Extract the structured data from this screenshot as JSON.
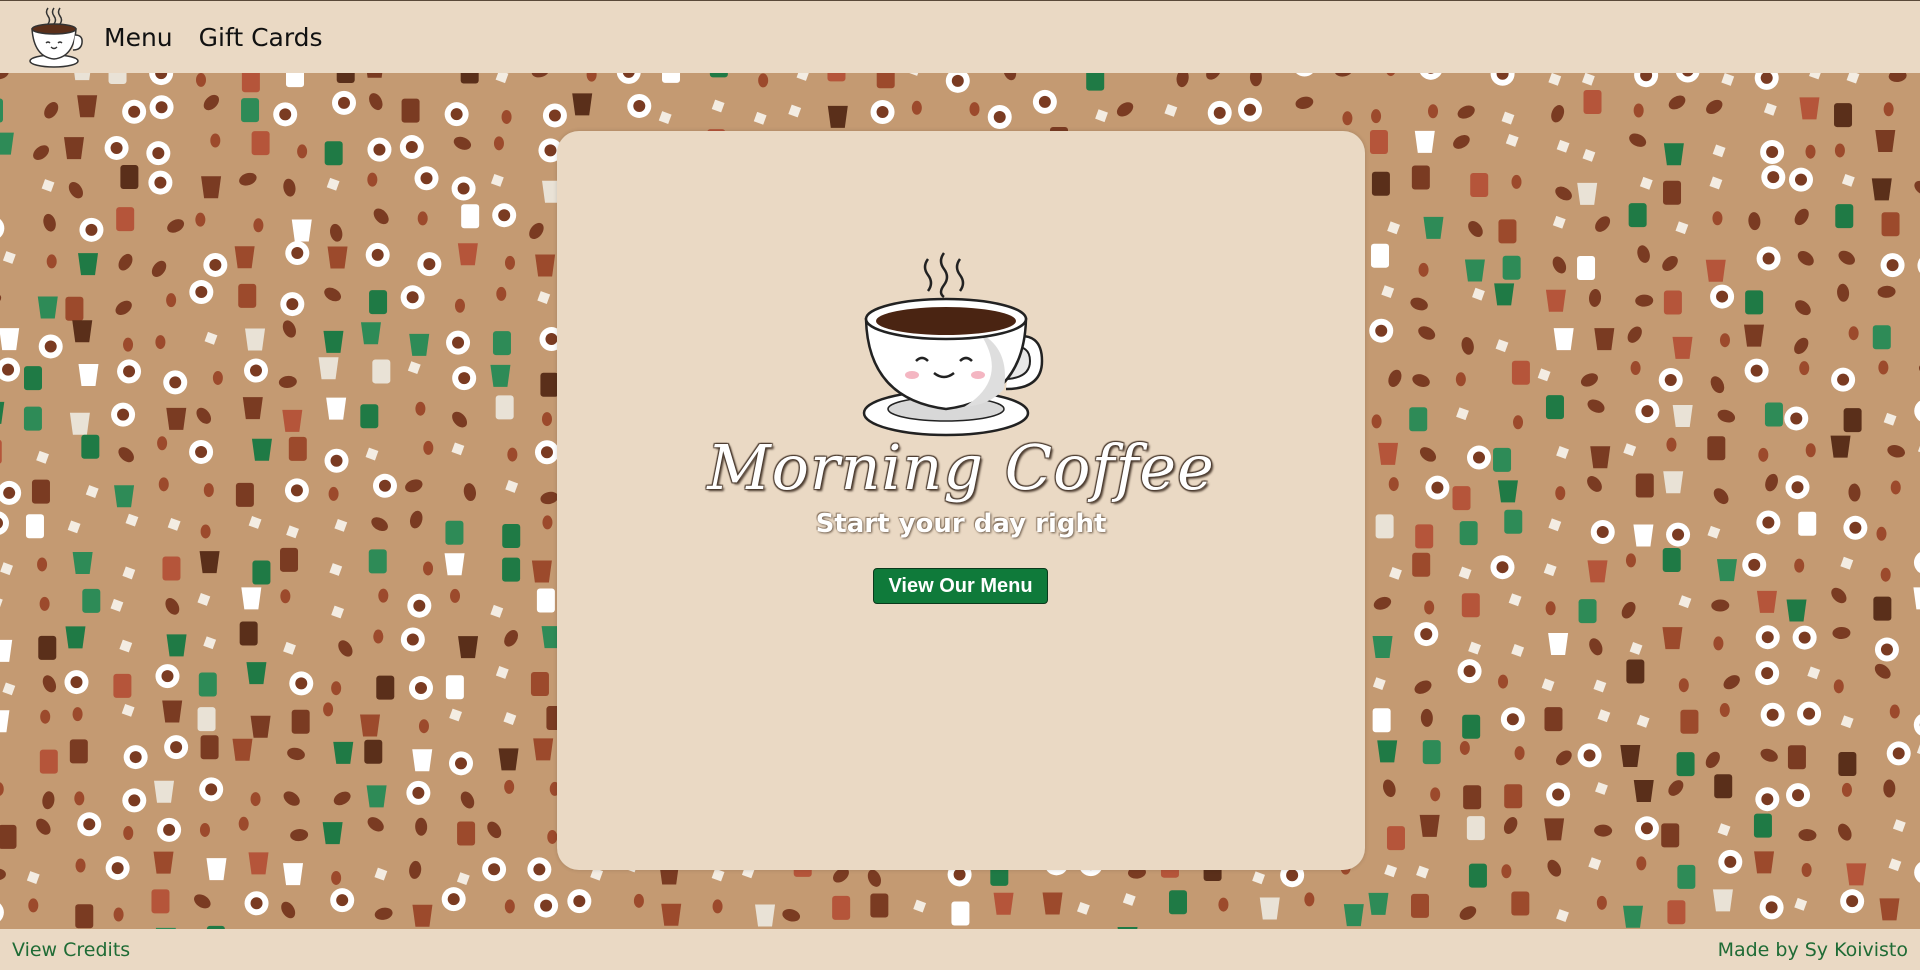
{
  "header": {
    "logo_icon": "coffee-cup-icon",
    "nav": [
      {
        "label": "Menu"
      },
      {
        "label": "Gift Cards"
      }
    ]
  },
  "background": {
    "pattern_icon": "coffee-pattern",
    "color": "#c49a72"
  },
  "hero": {
    "icon": "smiling-coffee-cup-icon",
    "title": "Morning Coffee",
    "subtitle": "Start your day right",
    "button_label": "View Our Menu",
    "button_color": "#0f7a3a"
  },
  "footer": {
    "credits_label": "View Credits",
    "author_label": "Made by Sy Koivisto",
    "link_color": "#1f6b35"
  }
}
